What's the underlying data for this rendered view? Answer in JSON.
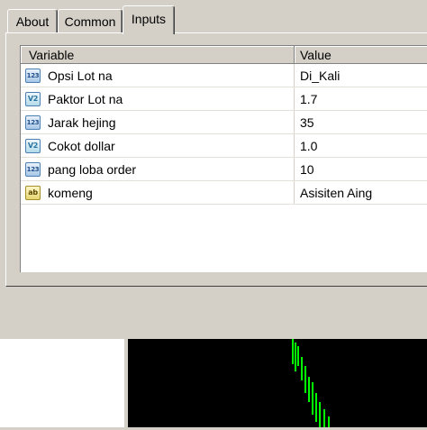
{
  "tabs": [
    {
      "label": "About"
    },
    {
      "label": "Common"
    },
    {
      "label": "Inputs"
    }
  ],
  "grid": {
    "headers": {
      "variable": "Variable",
      "value": "Value"
    },
    "rows": [
      {
        "type": "int",
        "icon": "123",
        "variable": "Opsi Lot na",
        "value": "Di_Kali"
      },
      {
        "type": "double",
        "icon": "V2",
        "variable": "Paktor Lot na",
        "value": "1.7"
      },
      {
        "type": "int",
        "icon": "123",
        "variable": "Jarak hejing",
        "value": "35"
      },
      {
        "type": "double",
        "icon": "V2",
        "variable": "Cokot dollar",
        "value": "1.0"
      },
      {
        "type": "int",
        "icon": "123",
        "variable": "pang loba order",
        "value": "10"
      },
      {
        "type": "string",
        "icon": "ab",
        "variable": "komeng",
        "value": "Asisiten Aing"
      }
    ]
  },
  "colors": {
    "chart_bg": "#000000",
    "candle": "#00ff00"
  }
}
